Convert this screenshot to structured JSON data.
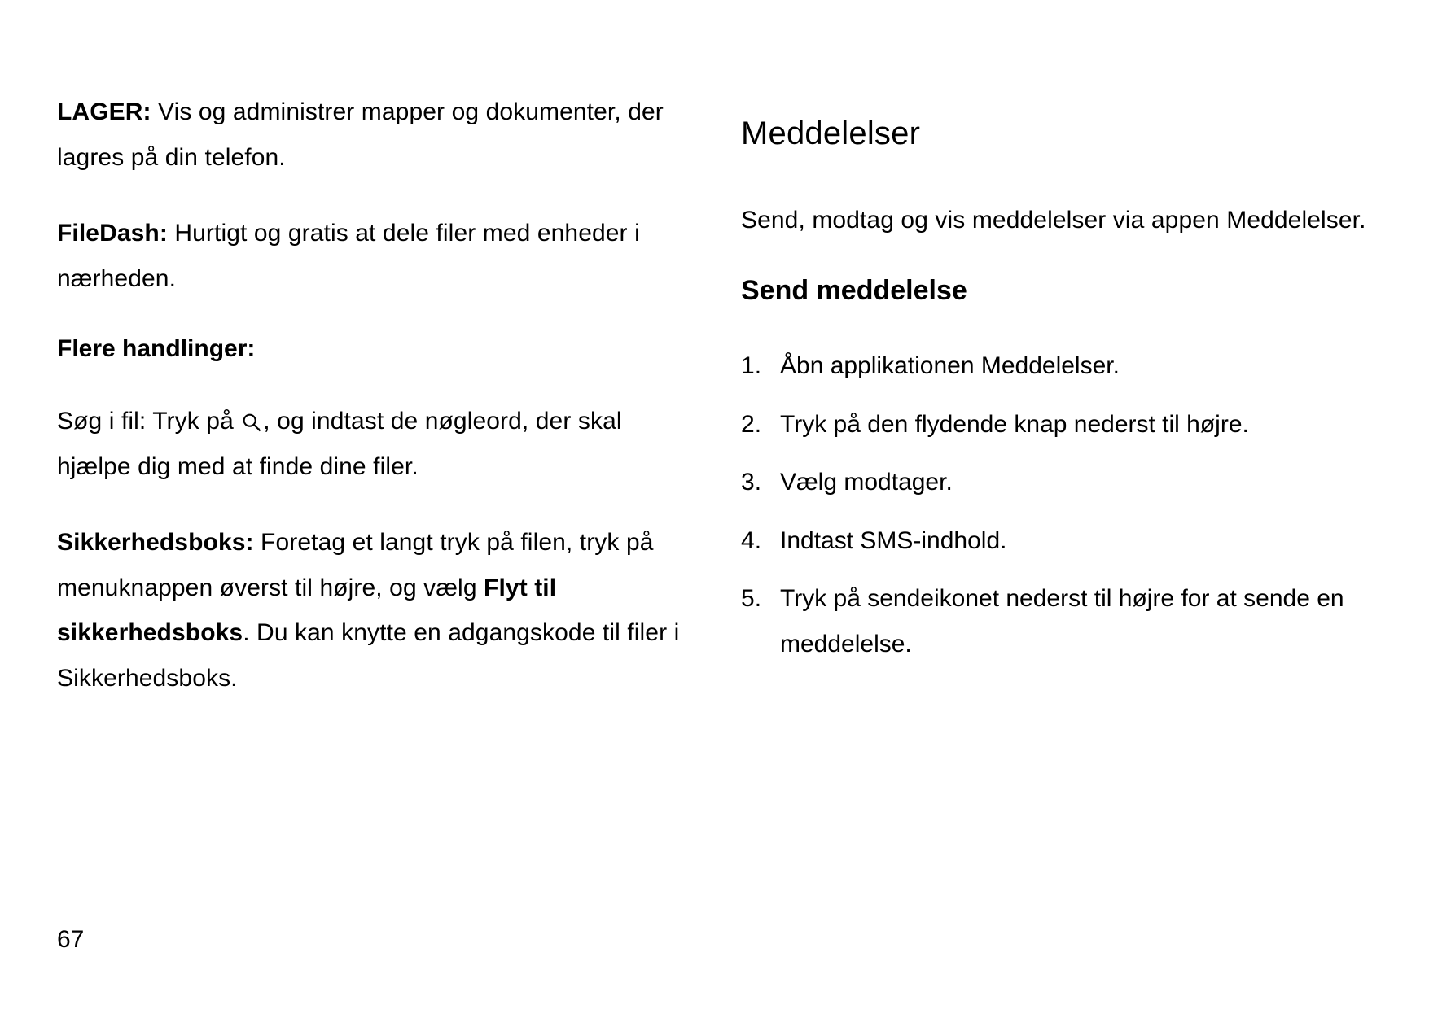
{
  "left": {
    "lager_label": "LAGER:",
    "lager_text": " Vis og administrer mapper og dokumenter, der lagres på din telefon.",
    "filedash_label": "FileDash:",
    "filedash_text": " Hurtigt og gratis at dele filer med enheder i nærheden.",
    "more_actions_heading": "Flere handlinger:",
    "search_prefix": "Søg i fil: Tryk på ",
    "search_suffix": ", og indtast de nøgleord, der skal hjælpe dig med at finde dine filer.",
    "safebox_label": "Sikkerhedsboks:",
    "safebox_text1": " Foretag et langt tryk på filen, tryk på menuknappen øverst til højre, og vælg ",
    "safebox_bold2": "Flyt til sikkerhedsboks",
    "safebox_text2": ". Du kan knytte en adgangskode til filer i Sikkerhedsboks."
  },
  "right": {
    "h1": "Meddelelser",
    "intro": "Send, modtag og vis meddelelser via appen Meddelelser.",
    "h2": "Send meddelelse",
    "steps": [
      "Åbn applikationen Meddelelser.",
      "Tryk på den flydende knap nederst til højre.",
      "Vælg modtager.",
      "Indtast SMS-indhold.",
      "Tryk på sendeikonet nederst til højre for at sende en meddelelse."
    ]
  },
  "page_number": "67"
}
